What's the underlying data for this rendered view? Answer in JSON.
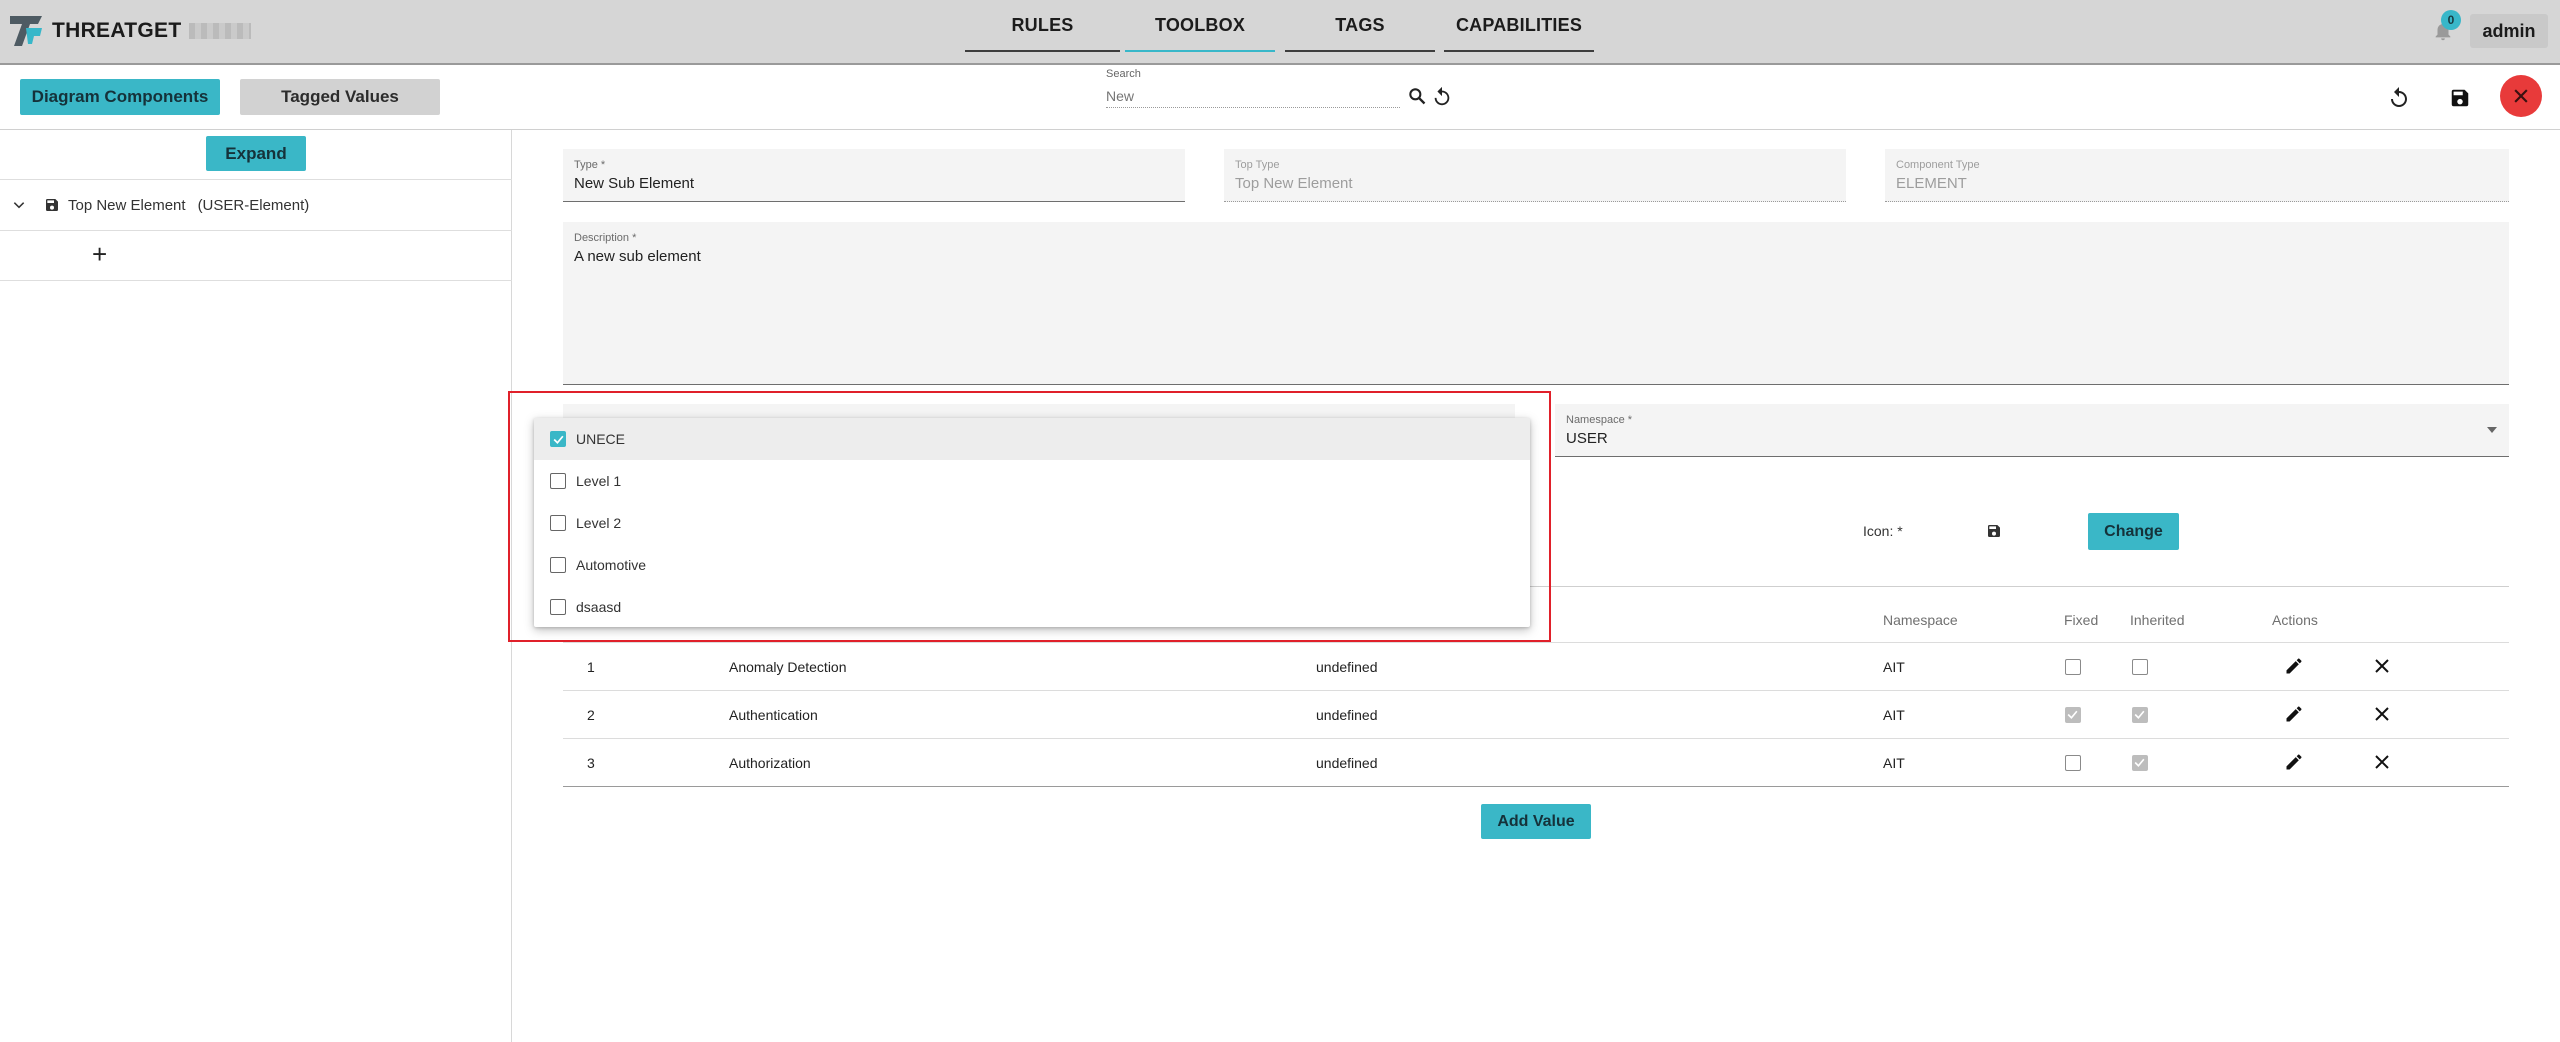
{
  "app": {
    "name": "THREATGET"
  },
  "nav": {
    "tabs": [
      {
        "label": "RULES"
      },
      {
        "label": "TOOLBOX"
      },
      {
        "label": "TAGS"
      },
      {
        "label": "CAPABILITIES"
      }
    ],
    "active_tab": "TOOLBOX",
    "notifications_count": "0",
    "user_label": "admin"
  },
  "toolbar": {
    "diagram_components_label": "Diagram Components",
    "tagged_values_label": "Tagged Values",
    "search_label": "Search",
    "search_placeholder": "New",
    "icons": [
      "search-icon",
      "refresh-icon",
      "undo-icon",
      "save-icon",
      "close-icon"
    ]
  },
  "left_panel": {
    "expand_label": "Expand",
    "tree": [
      {
        "label": "Top New Element",
        "type_label": "(USER-Element)",
        "icon": "floppy-icon"
      }
    ],
    "add_label": "+"
  },
  "form": {
    "type": {
      "label": "Type *",
      "value": "New Sub Element"
    },
    "top_type": {
      "label": "Top Type",
      "value": "Top New Element"
    },
    "component_type": {
      "label": "Component Type",
      "value": "ELEMENT"
    },
    "description": {
      "label": "Description *",
      "value": "A new sub element"
    },
    "namespace": {
      "label": "Namespace *",
      "value": "USER"
    },
    "icon_label": "Icon: *",
    "change_label": "Change"
  },
  "dropdown": {
    "items": [
      {
        "label": "UNECE",
        "checked": true
      },
      {
        "label": "Level 1",
        "checked": false
      },
      {
        "label": "Level 2",
        "checked": false
      },
      {
        "label": "Automotive",
        "checked": false
      },
      {
        "label": "dsaasd",
        "checked": false
      }
    ]
  },
  "table": {
    "headers": {
      "namespace": "Namespace",
      "fixed": "Fixed",
      "inherited": "Inherited",
      "actions": "Actions"
    },
    "rows": [
      {
        "index": "1",
        "name": "Anomaly Detection",
        "value": "undefined",
        "namespace": "AIT",
        "fixed": false,
        "inherited": false
      },
      {
        "index": "2",
        "name": "Authentication",
        "value": "undefined",
        "namespace": "AIT",
        "fixed": true,
        "inherited": true
      },
      {
        "index": "3",
        "name": "Authorization",
        "value": "undefined",
        "namespace": "AIT",
        "fixed": false,
        "inherited": true
      }
    ],
    "add_value_label": "Add Value"
  },
  "colors": {
    "accent": "#3ab7c7",
    "danger": "#e83a3a",
    "highlight": "#e0202a"
  }
}
